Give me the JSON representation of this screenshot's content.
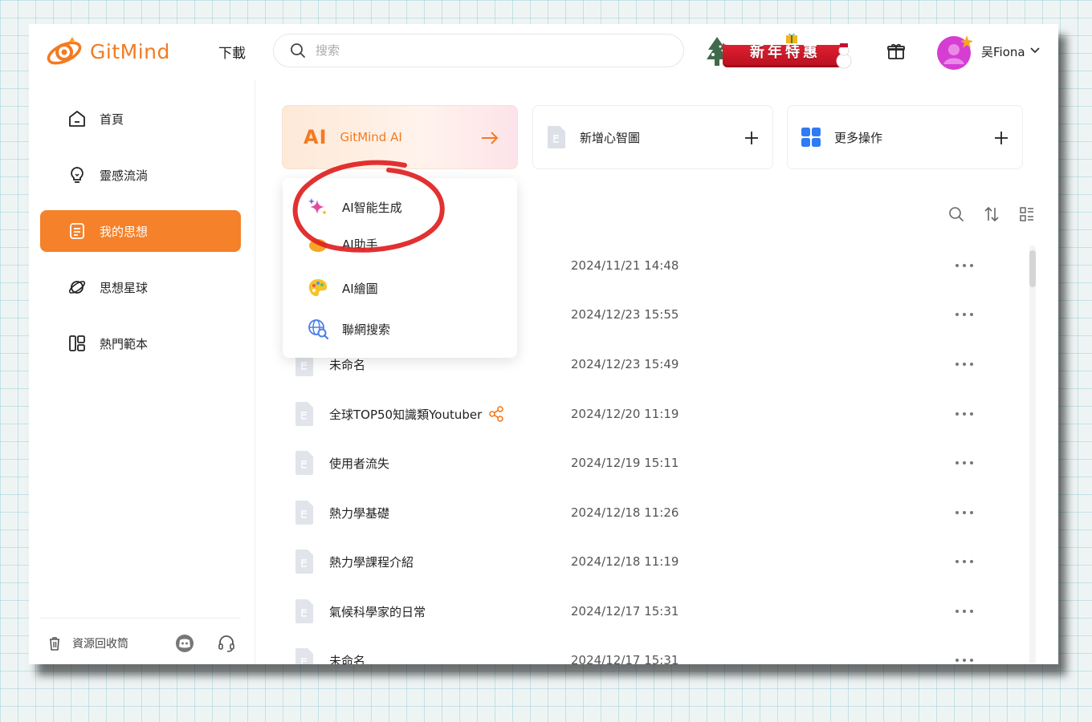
{
  "app": {
    "brand": "GitMind",
    "accent": "#f5812a"
  },
  "header": {
    "download_label": "下載",
    "search_placeholder": "搜索",
    "promo_text": "新年特惠",
    "user_name": "吴Fiona"
  },
  "sidebar": {
    "items": [
      {
        "label": "首頁",
        "icon": "home-icon"
      },
      {
        "label": "靈感流淌",
        "icon": "lightbulb-icon"
      },
      {
        "label": "我的思想",
        "icon": "document-icon",
        "active": true
      },
      {
        "label": "思想星球",
        "icon": "planet-icon"
      },
      {
        "label": "熱門範本",
        "icon": "template-icon"
      }
    ],
    "trash_label": "資源回收筒"
  },
  "cards": {
    "ai_mark": "AI",
    "ai_label": "GitMind AI",
    "new_label": "新增心智圖",
    "more_label": "更多操作"
  },
  "ai_menu": {
    "items": [
      {
        "label": "AI智能生成",
        "icon": "sparkle-icon"
      },
      {
        "label": "AI助手",
        "icon": "assistant-icon"
      },
      {
        "label": "AI繪圖",
        "icon": "palette-icon"
      },
      {
        "label": "聯網搜索",
        "icon": "globe-search-icon"
      }
    ]
  },
  "files": [
    {
      "name": "",
      "date": "2024/11/21 14:48"
    },
    {
      "name": "",
      "date": "2024/12/23 15:55"
    },
    {
      "name": "未命名",
      "date": "2024/12/23 15:49"
    },
    {
      "name": "全球TOP50知識類Youtuber",
      "date": "2024/12/20 11:19",
      "shared": true
    },
    {
      "name": "使用者流失",
      "date": "2024/12/19 15:11"
    },
    {
      "name": "熱力學基礎",
      "date": "2024/12/18 11:26"
    },
    {
      "name": "熱力學課程介紹",
      "date": "2024/12/18 11:19"
    },
    {
      "name": "氣候科學家的日常",
      "date": "2024/12/17 15:31"
    },
    {
      "name": "未命名",
      "date": "2024/12/17 15:31"
    }
  ]
}
